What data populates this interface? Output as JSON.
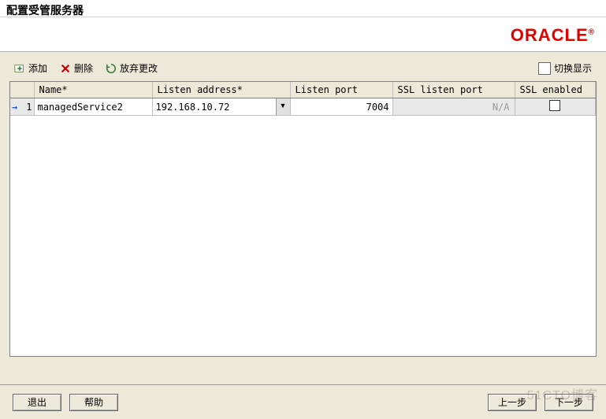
{
  "window": {
    "title": "配置受管服务器"
  },
  "logo": {
    "text": "ORACLE"
  },
  "toolbar": {
    "add_label": "添加",
    "delete_label": "删除",
    "discard_label": "放弃更改",
    "switch_view_label": "切换显示"
  },
  "table": {
    "headers": {
      "name": "Name*",
      "listen_address": "Listen address*",
      "listen_port": "Listen port",
      "ssl_listen_port": "SSL listen port",
      "ssl_enabled": "SSL enabled"
    },
    "rows": [
      {
        "index": "1",
        "name": "managedService2",
        "listen_address": "192.168.10.72",
        "listen_port": "7004",
        "ssl_listen_port": "N/A",
        "ssl_enabled": false
      }
    ]
  },
  "footer": {
    "exit_label": "退出",
    "help_label": "帮助",
    "prev_label": "上一步",
    "next_label": "下一步"
  },
  "watermark": "51CTO博客"
}
